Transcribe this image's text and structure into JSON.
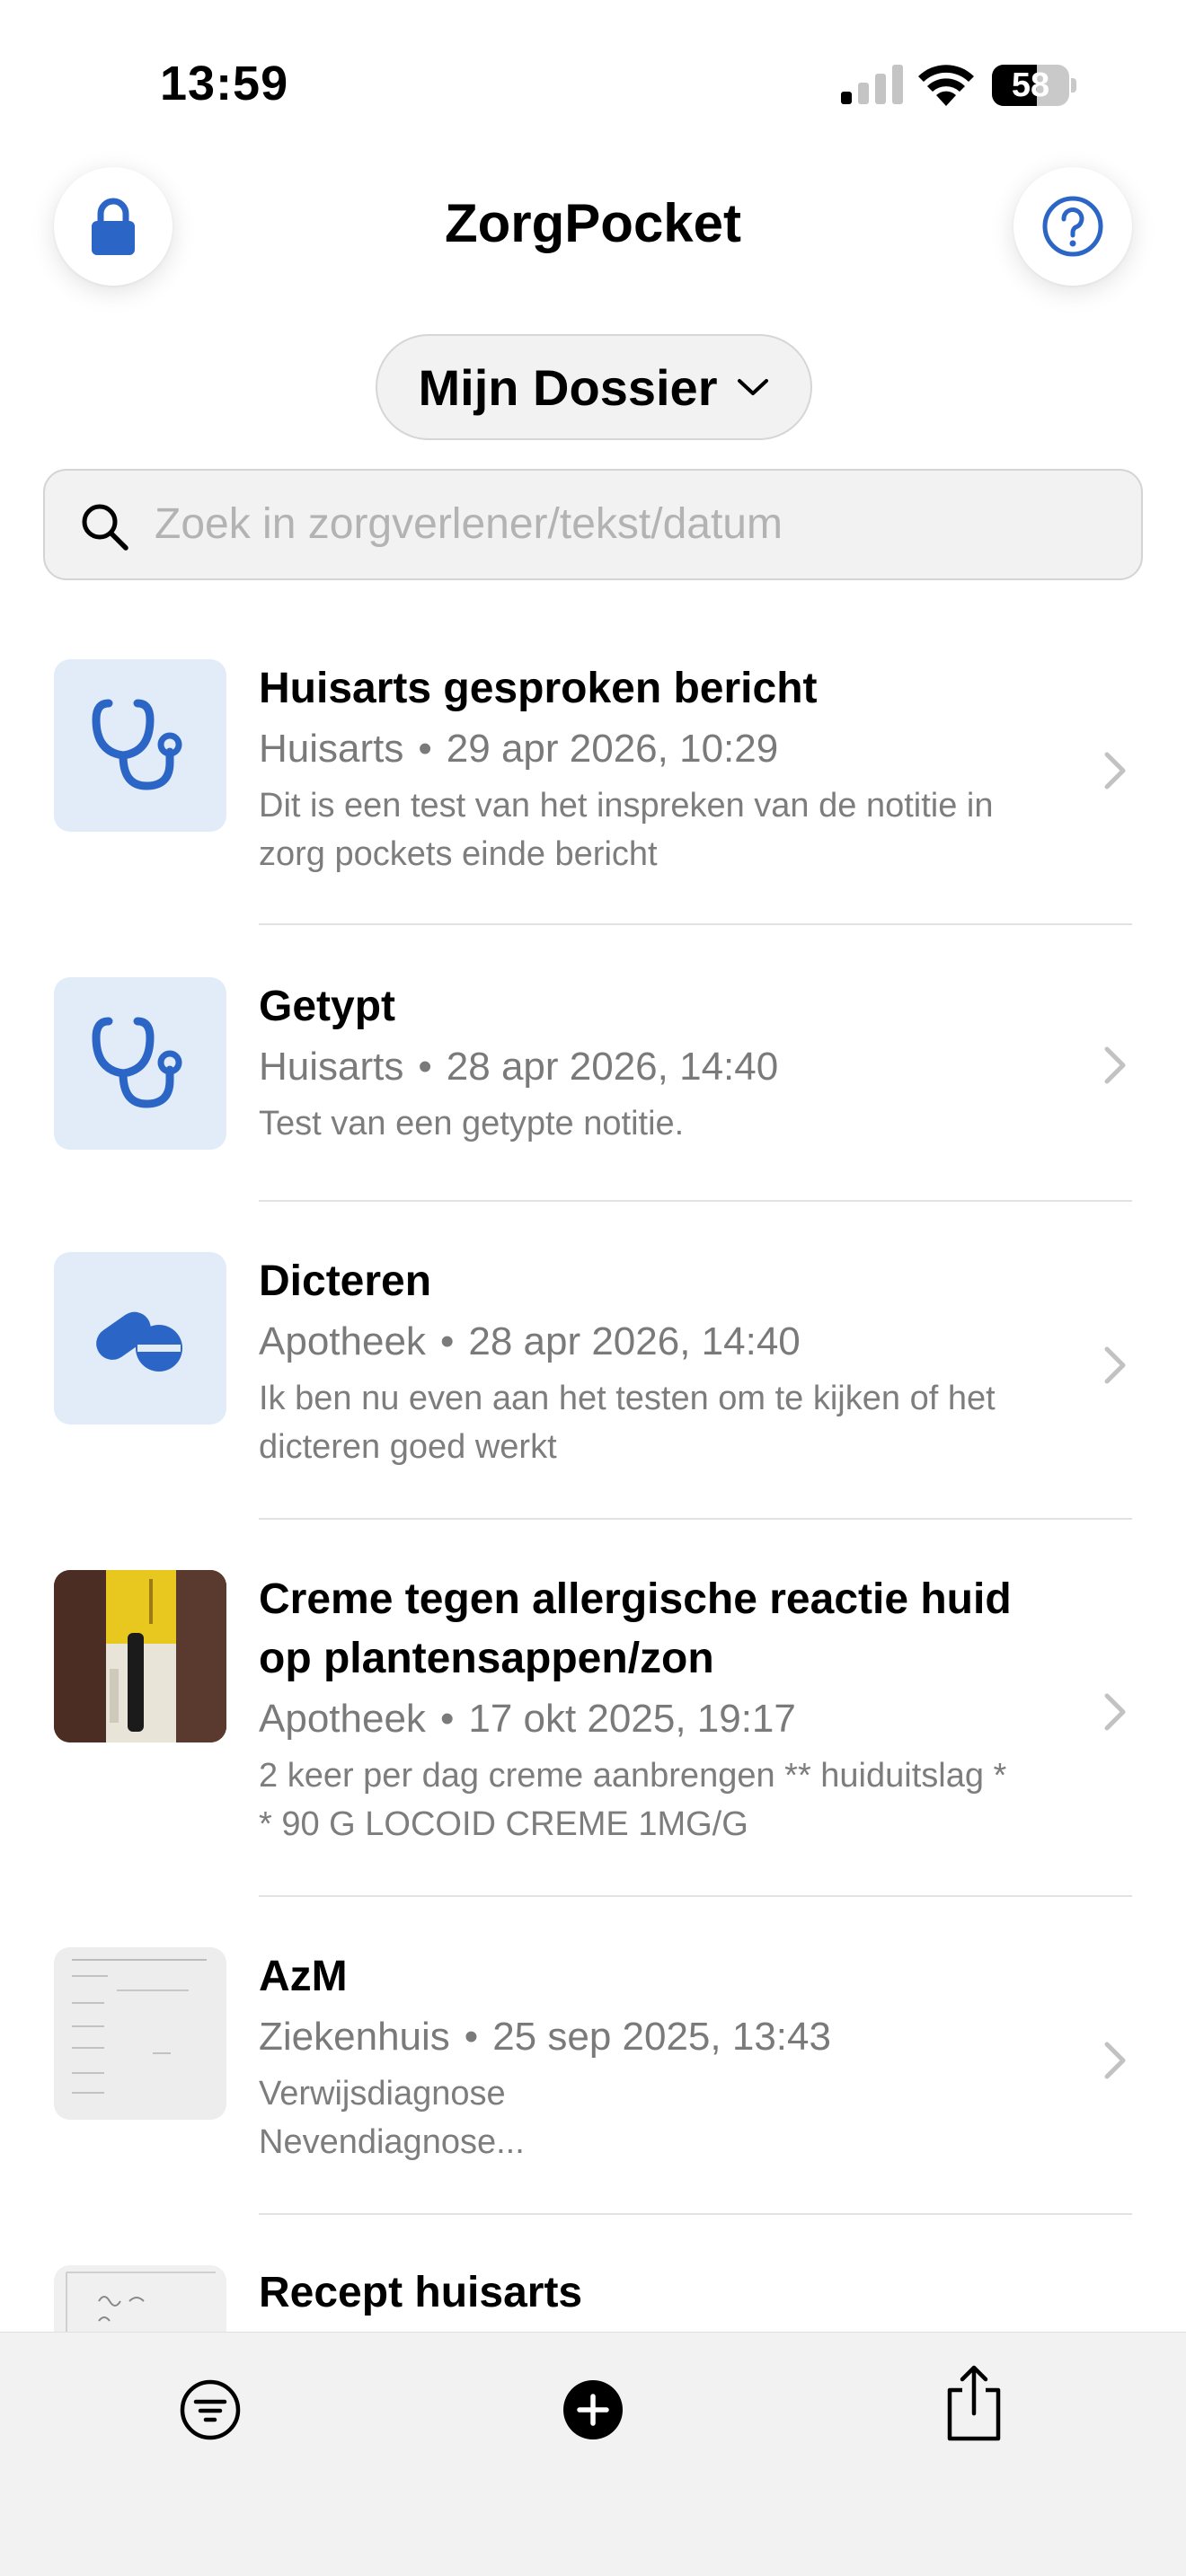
{
  "status_bar": {
    "time": "13:59",
    "battery": "58",
    "battery_level": 0.58
  },
  "header": {
    "title": "ZorgPocket",
    "lock_icon": "lock-icon",
    "help_icon": "question-circle-icon"
  },
  "dossier": {
    "label": "Mijn Dossier"
  },
  "search": {
    "placeholder": "Zoek in zorgverlener/tekst/datum"
  },
  "accent": "#2b66c7",
  "list": [
    {
      "title": "Huisarts gesproken bericht",
      "provider": "Huisarts",
      "date": "29 apr 2026, 10:29",
      "desc1": "Dit is een test van het inspreken van de notitie in",
      "desc2": "zorg pockets einde bericht",
      "icon": "stethoscope-icon"
    },
    {
      "title": "Getypt",
      "provider": "Huisarts",
      "date": "28 apr 2026, 14:40",
      "desc1": "Test van een getypte notitie.",
      "icon": "stethoscope-icon"
    },
    {
      "title": "Dicteren",
      "provider": "Apotheek",
      "date": "28 apr 2026, 14:40",
      "desc1": "Ik ben nu even aan het testen om te kijken of het",
      "desc2": "dicteren goed werkt",
      "icon": "pills-icon"
    },
    {
      "title1": "Creme tegen allergische reactie huid",
      "title2": "op plantensappen/zon",
      "provider": "Apotheek",
      "date": "17 okt 2025, 19:17",
      "desc1": "2 keer per dag creme aanbrengen ** huiduitslag *",
      "desc2": "* 90 G LOCOID CREME 1MG/G",
      "icon": "photo-thumbnail"
    },
    {
      "title": "AzM",
      "provider": "Ziekenhuis",
      "date": "25 sep 2025, 13:43",
      "desc1": "Verwijsdiagnose",
      "desc2": "Nevendiagnose...",
      "icon": "document-thumbnail"
    },
    {
      "title": "Recept huisarts",
      "icon": "handwritten-thumbnail"
    }
  ],
  "toolbar": {
    "filter_icon": "filter-icon",
    "add_icon": "plus-circle-icon",
    "share_icon": "share-icon"
  }
}
